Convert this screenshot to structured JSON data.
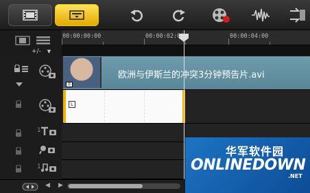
{
  "toolbar": {
    "storyboard_icon": "filmstrip-icon",
    "timeline_icon": "timeline-icon",
    "undo_icon": "undo-icon",
    "redo_icon": "redo-icon",
    "record_icon": "record-capture-icon",
    "audio_icon": "audio-waveform-icon",
    "more_icon": "auto-music-icon"
  },
  "ruler": {
    "ticks": [
      "00:00:00:00",
      "00:00:02:00",
      "00:00:04:00"
    ]
  },
  "zoom": {
    "label": "+/-"
  },
  "clips": {
    "video_name": "欧洲与伊斯兰的冲突3分钟预告片.avi",
    "title_marker": "L"
  },
  "tracks": [
    {
      "name": "video-track",
      "icon": "film-reel-icon"
    },
    {
      "name": "overlay-track",
      "icon": "overlay-icon"
    },
    {
      "name": "title-track",
      "icon": "title-icon",
      "prefix": "1"
    },
    {
      "name": "voice-track",
      "icon": "microphone-icon"
    },
    {
      "name": "music-track",
      "icon": "music-note-icon",
      "prefix": "1"
    }
  ],
  "watermark": {
    "cn": "华军软件园",
    "logo": "ONLINEDOWN",
    "net": ".NET"
  }
}
